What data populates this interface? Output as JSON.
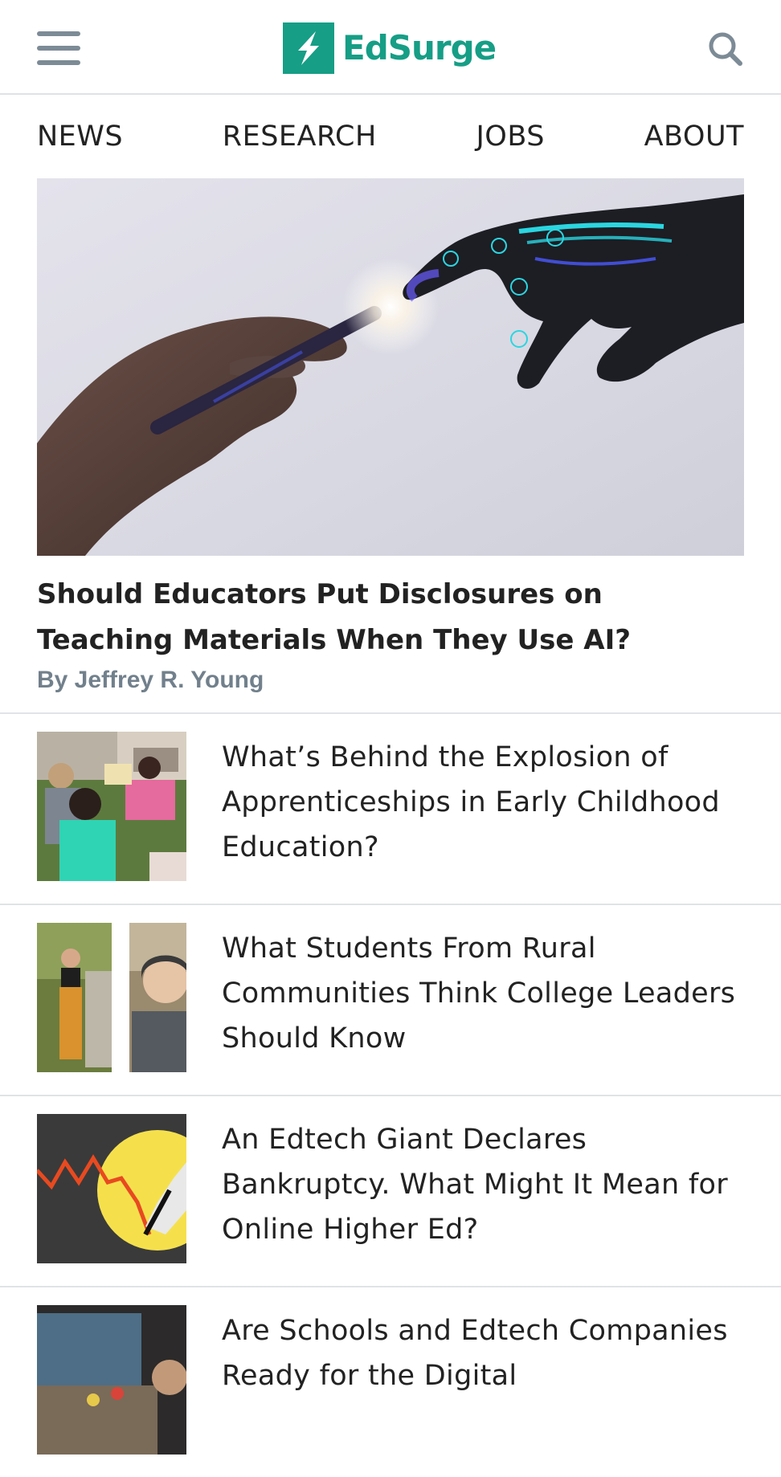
{
  "header": {
    "logo_text": "EdSurge",
    "brand_color": "#169e86",
    "menu_icon": "hamburger-menu-icon",
    "search_icon": "search-icon"
  },
  "nav": {
    "items": [
      {
        "label": "NEWS"
      },
      {
        "label": "RESEARCH"
      },
      {
        "label": "JOBS"
      },
      {
        "label": "ABOUT"
      }
    ]
  },
  "hero": {
    "image_alt": "A human hand holding a stylus reaching toward a robotic hand",
    "title": "Should Educators Put Disclosures on Teaching Materials When They Use AI?",
    "byline": "By Jeffrey R. Young"
  },
  "stories": [
    {
      "title": "What’s Behind the Explosion of Apprenticeships in Early Childhood Education?"
    },
    {
      "title": "What Students From Rural Communities Think College Leaders Should Know"
    },
    {
      "title": "An Edtech Giant Declares Bankruptcy. What Might It Mean for Online Higher Ed?"
    },
    {
      "title": "Are Schools and Edtech Companies Ready for the Digital"
    }
  ]
}
